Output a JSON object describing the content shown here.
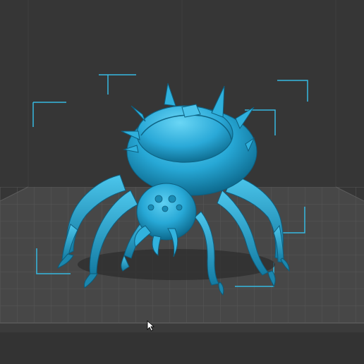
{
  "app": {
    "view": "3d-print-preview",
    "background_color": "#363636",
    "bed_color": "#4a4a4a",
    "grid_color": "#5a5a5a",
    "model_color": "#27a8d6",
    "bounding_box_color": "#37b9e0"
  },
  "scene": {
    "model_name_icon": "spider-monster-model",
    "cursor_icon": "arrow-pointer-icon"
  }
}
